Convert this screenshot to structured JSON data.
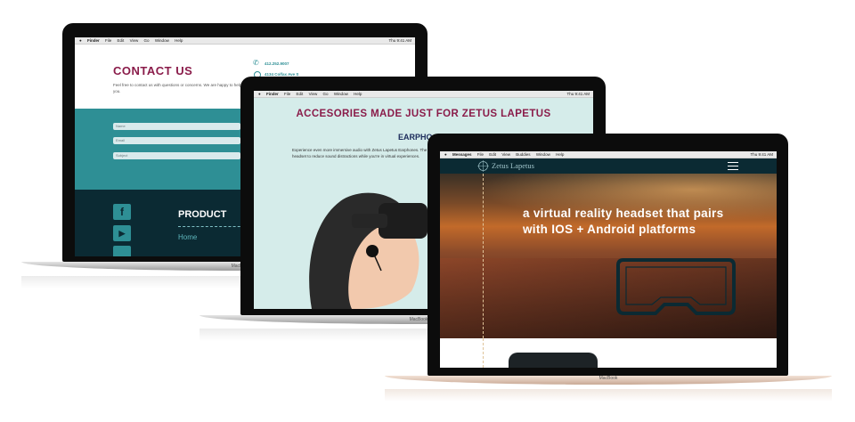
{
  "menubar_left": {
    "apple": "",
    "app": "Finder",
    "items": [
      "File",
      "Edit",
      "View",
      "Go",
      "Window",
      "Help"
    ]
  },
  "menubar_right": {
    "icons": "⌘ ✱ ◉ ◔ 🔋",
    "time": "Thu 9:41 AM"
  },
  "menubar_messages": {
    "app": "Messages",
    "items": [
      "File",
      "Edit",
      "View",
      "Buddies",
      "Window",
      "Help"
    ],
    "time": "Thu 9:41 AM"
  },
  "laptop1": {
    "title": "CONTACT US",
    "intro": "Feel free to contact us with questions or concerns. We are happy to help you.",
    "phone": "412.252.9007",
    "address": "4134 Colfax Ave S",
    "fields": [
      {
        "placeholder": "Name"
      },
      {
        "placeholder": "Email"
      },
      {
        "placeholder": "Subject"
      }
    ],
    "footer_heading": "PRODUCT",
    "footer_link": "Home",
    "brand": "MacBook"
  },
  "laptop2": {
    "title": "ACCESORIES MADE JUST FOR ZETUS LAPETUS",
    "subtitle": "EARPHO",
    "body": "Experience even more immersive audio with Zetus Lapetus Earphones. The headset to reduce sound distractions while you're in virtual experiences.",
    "brand": "MacBook"
  },
  "laptop3": {
    "logo_text": "Zetus Lapetus",
    "hero_line1": "a virtual reality headset that pairs",
    "hero_line2": "with IOS + Android platforms",
    "brand": "MacBook"
  },
  "colors": {
    "maroon": "#8a1c4a",
    "teal": "#2e8f95",
    "dark_teal": "#0b2a33",
    "mint": "#d5ecea",
    "navy": "#1b2a5a"
  }
}
